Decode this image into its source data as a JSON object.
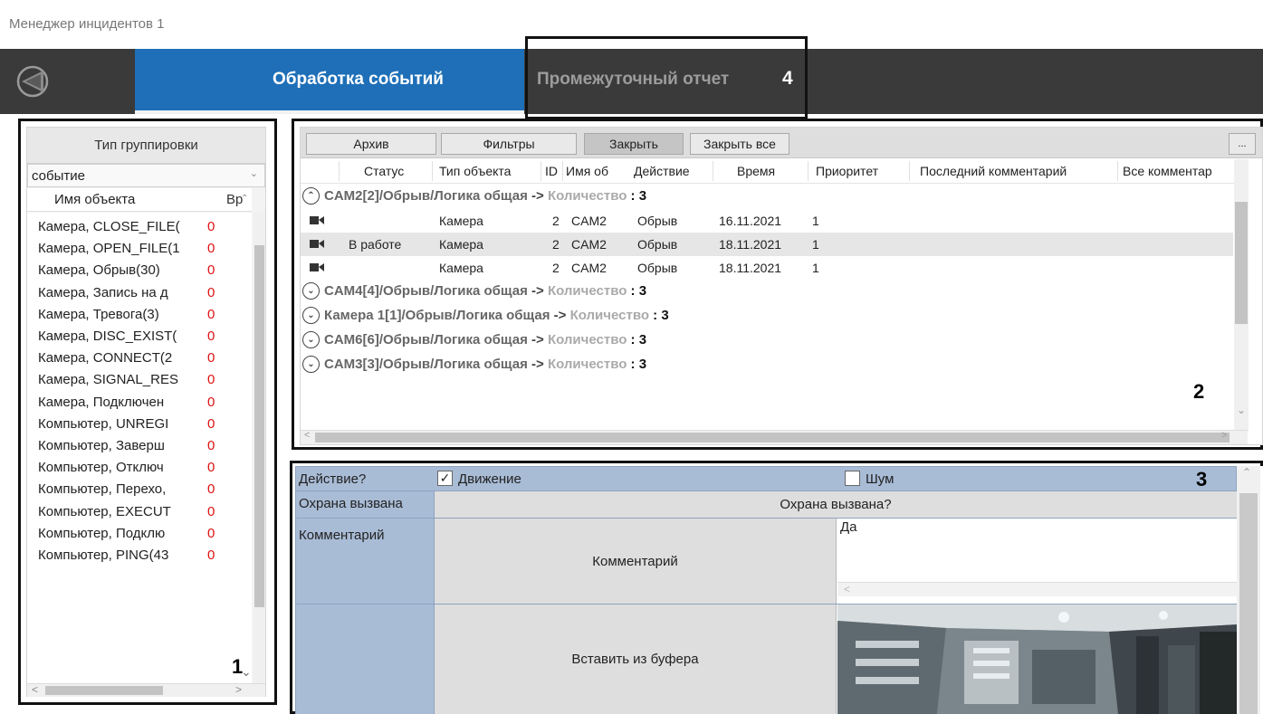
{
  "window": {
    "title": "Менеджер инцидентов 1"
  },
  "nav": {
    "tabs": [
      {
        "label": "Обработка событий",
        "active": true
      },
      {
        "label": "Промежуточный отчет",
        "active": false
      }
    ],
    "tab_accent_color": "#1e6fb8",
    "bar_color": "#3a3a3a"
  },
  "callouts": [
    "1",
    "2",
    "3",
    "4"
  ],
  "grouping_panel": {
    "header": "Тип группировки",
    "select_value": "событие",
    "columns": [
      "Имя объекта",
      "Вр"
    ],
    "rows": [
      {
        "name": "Камера, CLOSE_FILE(",
        "count": "0"
      },
      {
        "name": "Камера, OPEN_FILE(1",
        "count": "0"
      },
      {
        "name": "Камера, Обрыв(30)",
        "count": "0"
      },
      {
        "name": "Камера, Запись на д",
        "count": "0"
      },
      {
        "name": "Камера, Тревога(3)",
        "count": "0"
      },
      {
        "name": "Камера, DISC_EXIST(",
        "count": "0"
      },
      {
        "name": "Камера, CONNECT(2",
        "count": "0"
      },
      {
        "name": "Камера, SIGNAL_RES",
        "count": "0"
      },
      {
        "name": "Камера, Подключен",
        "count": "0"
      },
      {
        "name": "Компьютер, UNREGI",
        "count": "0"
      },
      {
        "name": "Компьютер, Заверш",
        "count": "0"
      },
      {
        "name": "Компьютер, Отключ",
        "count": "0"
      },
      {
        "name": "Компьютер, Перехо,",
        "count": "0"
      },
      {
        "name": "Компьютер, EXECUT",
        "count": "0"
      },
      {
        "name": "Компьютер, Подклю",
        "count": "0"
      },
      {
        "name": "Компьютер, PING(43",
        "count": "0"
      }
    ]
  },
  "events_panel": {
    "toolbar": {
      "archive": "Архив",
      "filters": "Фильтры",
      "close": "Закрыть",
      "close_all": "Закрыть все",
      "more": "..."
    },
    "columns": [
      "Статус",
      "Тип объекта",
      "ID",
      "Имя об",
      "Действие",
      "Время",
      "Приоритет",
      "Последний комментарий",
      "Все комментар"
    ],
    "groups": [
      {
        "name": "CAM2[2]/Обрыв/Логика общая",
        "arrow": "->",
        "count_label": "Количество",
        "count": ": 3",
        "expanded": true,
        "events": [
          {
            "status": "",
            "type": "Камера",
            "id": "2",
            "name": "CAM2",
            "action": "Обрыв",
            "time": "16.11.2021",
            "priority": "1",
            "selected": false
          },
          {
            "status": "В работе",
            "type": "Камера",
            "id": "2",
            "name": "CAM2",
            "action": "Обрыв",
            "time": "18.11.2021",
            "priority": "1",
            "selected": true
          },
          {
            "status": "",
            "type": "Камера",
            "id": "2",
            "name": "CAM2",
            "action": "Обрыв",
            "time": "18.11.2021",
            "priority": "1",
            "selected": false
          }
        ]
      },
      {
        "name": "CAM4[4]/Обрыв/Логика общая",
        "arrow": "->",
        "count_label": "Количество",
        "count": ": 3",
        "expanded": false
      },
      {
        "name": "Камера 1[1]/Обрыв/Логика общая",
        "arrow": "->",
        "count_label": "Количество",
        "count": ": 3",
        "expanded": false
      },
      {
        "name": "CAM6[6]/Обрыв/Логика общая",
        "arrow": "->",
        "count_label": "Количество",
        "count": ": 3",
        "expanded": false
      },
      {
        "name": "CAM3[3]/Обрыв/Логика общая",
        "arrow": "->",
        "count_label": "Количество",
        "count": ": 3",
        "expanded": false
      }
    ]
  },
  "detail_panel": {
    "action_label": "Действие?",
    "motion": {
      "label": "Движение",
      "checked": true
    },
    "noise": {
      "label": "Шум",
      "checked": false
    },
    "guard_label": "Охрана вызвана",
    "guard_value": "Охрана вызвана?",
    "comment_label": "Комментарий",
    "comment_button": "Комментарий",
    "comment_text": "Да",
    "paste_button": "Вставить из буфера",
    "header_color": "#a9bcd6"
  }
}
